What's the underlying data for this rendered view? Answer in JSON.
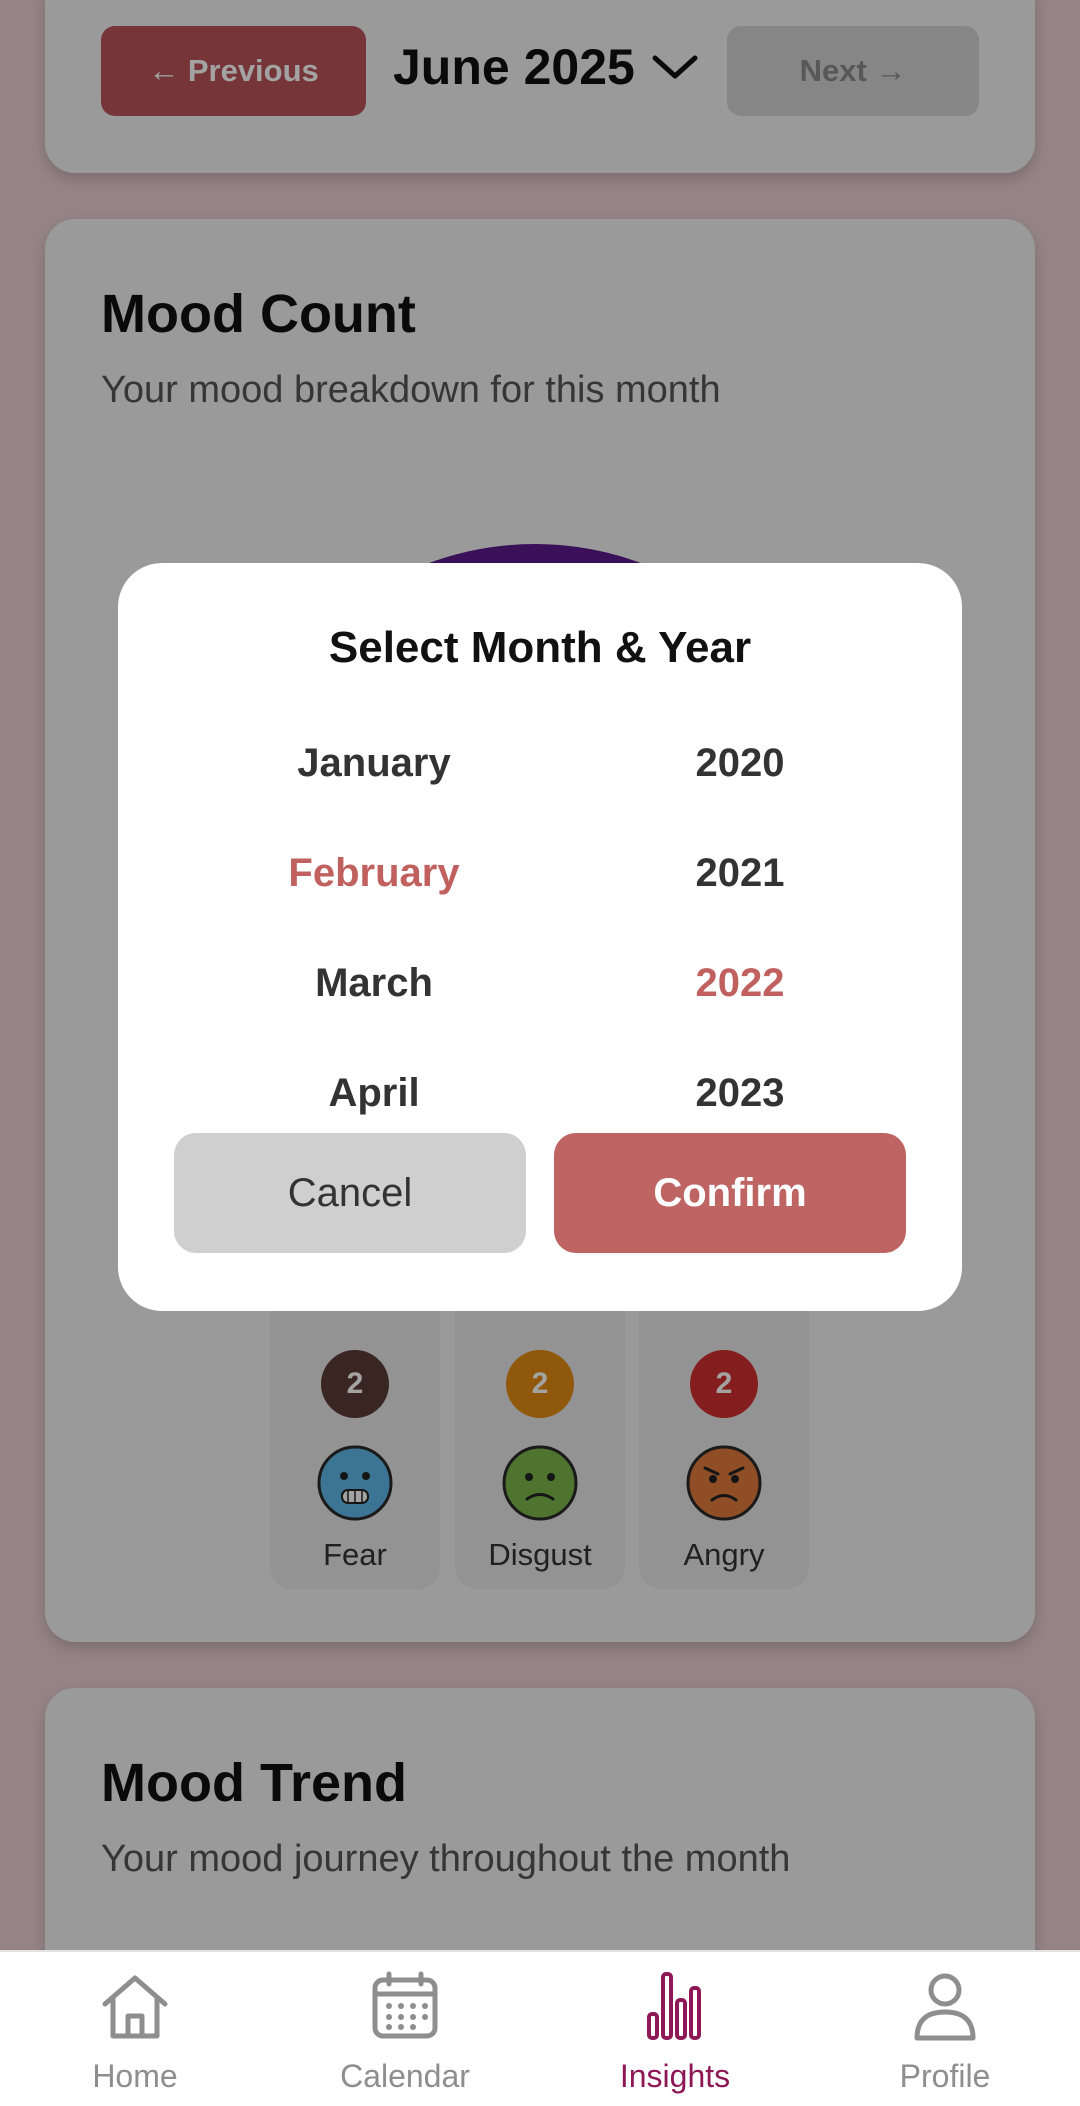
{
  "header": {
    "prev_label": "← Previous",
    "month_label": "June 2025",
    "next_label": "Next →"
  },
  "mood_count": {
    "title": "Mood Count",
    "subtitle": "Your mood breakdown for this month",
    "moods": [
      {
        "label": "Fear",
        "count": "2",
        "badge_color": "#5a3a35"
      },
      {
        "label": "Disgust",
        "count": "2",
        "badge_color": "#e08a10"
      },
      {
        "label": "Angry",
        "count": "2",
        "badge_color": "#cf2f2f"
      }
    ]
  },
  "mood_trend": {
    "title": "Mood Trend",
    "subtitle": "Your mood journey throughout the month"
  },
  "picker": {
    "title": "Select Month & Year",
    "months": [
      "January",
      "February",
      "March",
      "April"
    ],
    "years": [
      "2020",
      "2021",
      "2022",
      "2023"
    ],
    "selected_month": "February",
    "selected_year": "2022",
    "cancel_label": "Cancel",
    "confirm_label": "Confirm"
  },
  "bottom_nav": {
    "items": [
      {
        "label": "Home",
        "icon": "home-icon"
      },
      {
        "label": "Calendar",
        "icon": "calendar-icon"
      },
      {
        "label": "Insights",
        "icon": "bar-chart-icon",
        "active": true
      },
      {
        "label": "Profile",
        "icon": "person-icon"
      }
    ]
  },
  "colors": {
    "accent": "#be6463",
    "active_nav": "#8e1756"
  }
}
